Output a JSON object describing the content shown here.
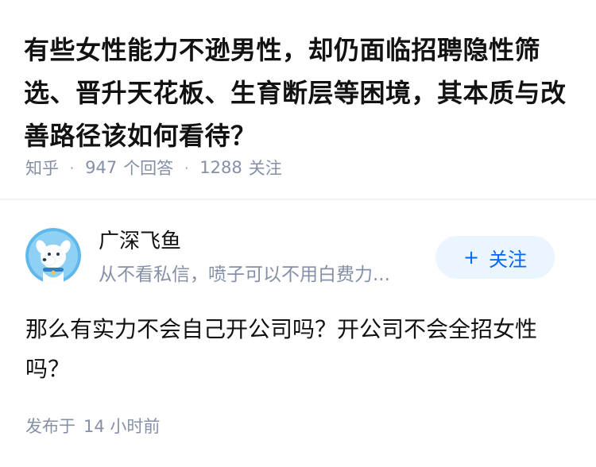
{
  "question": {
    "title": "有些女性能力不逊男性，却仍面临招聘隐性筛选、晋升天花板、生育断层等困境，其本质与改善路径该如何看待？",
    "source": "知乎",
    "answers_count": "947",
    "answers_label": "个回答",
    "followers_count": "1288",
    "followers_label": "关注"
  },
  "answer": {
    "author": {
      "name": "广深飞鱼",
      "bio": "从不看私信，喷子可以不用白费力...",
      "avatar_icon": "dog-avatar-icon"
    },
    "follow_button": {
      "icon": "plus-icon",
      "label": "关注"
    },
    "content": "那么有实力不会自己开公司吗？开公司不会全招女性吗？",
    "published_label": "发布于",
    "published_time": "14 小时前"
  },
  "colors": {
    "text_primary": "#121212",
    "text_secondary": "#8590a6",
    "accent": "#0066ff",
    "follow_bg": "#ebf5ff",
    "avatar_bg": "#5fb7ea"
  }
}
